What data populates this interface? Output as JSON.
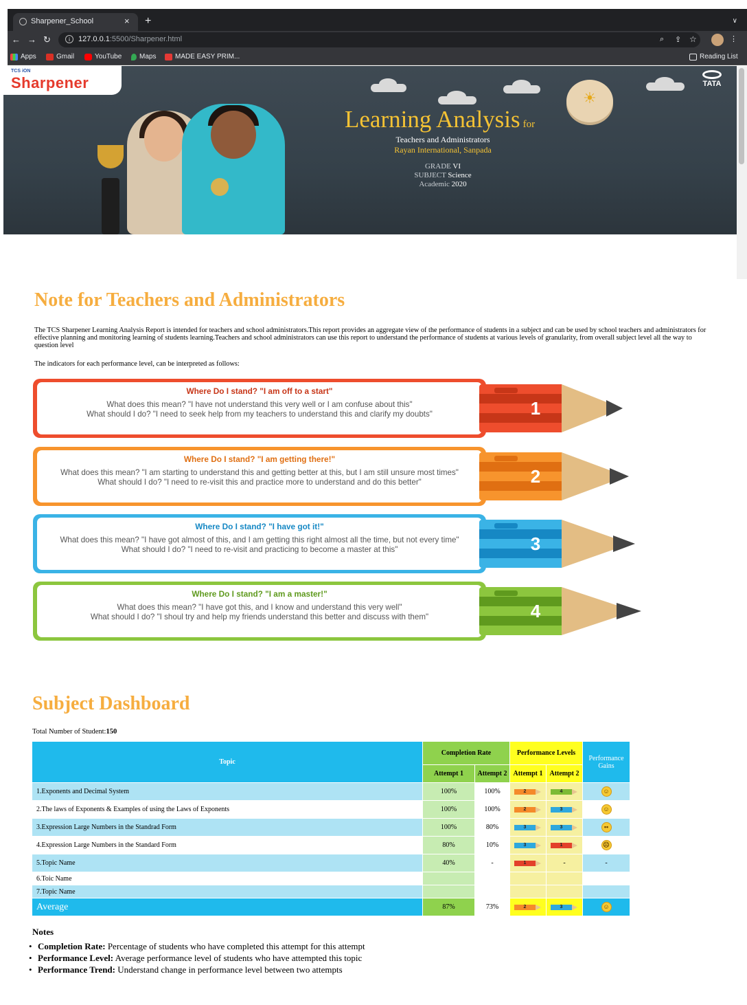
{
  "browser": {
    "tab_title": "Sharpener_School",
    "tab_close": "×",
    "new_tab": "+",
    "url_host": "127.0.0.1",
    "url_path": ":5500/Sharpener.html",
    "bookmarks": [
      "Apps",
      "Gmail",
      "YouTube",
      "Maps",
      "MADE EASY PRIM..."
    ],
    "reading_list": "Reading List"
  },
  "hero": {
    "brand_small": "TCS iON",
    "brand": "Sharpener",
    "tata": "TATA",
    "title": "Learning Analysis",
    "title_for": "for",
    "audience": "Teachers and Administrators",
    "school": "Rayan International, Sanpada",
    "grade_label": "GRADE",
    "grade": "VI",
    "subject_label": "SUBJECT",
    "subject": "Science",
    "academic_label": "Academic",
    "academic": "2020"
  },
  "note": {
    "heading": "Note for Teachers and Administrators",
    "intro": "The TCS Sharpener Learning Analysis Report is intended for teachers and school administrators.This report provides an aggregate view of the performance of students in a subject and can be used by school teachers and administrators for effective planning and monitoring learning of students learning.Teachers and school administrators can use this report to understand the performance of students at various levels of granularity, from overall subject level all the way to question level",
    "indicators": "The indicators for each performance level, can be interpreted as follows:",
    "levels": [
      {
        "num": "1",
        "question": "Where Do I stand? \"I am off to a start\"",
        "meaning": "What does this mean? \"I have not understand this very well or I am confuse about this\"",
        "action": "What should I do? \"I need to seek help from my teachers to understand this and clarify my doubts\"",
        "color": "#ee4d2d",
        "dark": "#c73618"
      },
      {
        "num": "2",
        "question": "Where Do I stand? \"I am getting there!\"",
        "meaning": "What does this mean? \"I am starting to understand this and getting better at this, but I am still unsure most times\"",
        "action": "What should I do? \"I need to re-visit this and practice more to understand and do this better\"",
        "color": "#f7942d",
        "dark": "#e06f12"
      },
      {
        "num": "3",
        "question": "Where Do I stand? \"I have got it!\"",
        "meaning": "What does this mean? \"I have got almost of this, and I am getting this right almost all the time, but not every time\"",
        "action": "What should I do? \"I need to re-visit and practicing to become a master at this\"",
        "color": "#3ab3e6",
        "dark": "#1688c4"
      },
      {
        "num": "4",
        "question": "Where Do I stand? \"I am a master!\"",
        "meaning": "What does this mean? \"I have got this, and I know and understand this very well\"",
        "action": "What should I do? \"I shoul try and help my friends understand this better and discuss with them\"",
        "color": "#8cc63e",
        "dark": "#5f9a1e"
      }
    ]
  },
  "dashboard": {
    "heading": "Subject Dashboard",
    "total_label": "Total Number of Student:",
    "total": "150",
    "headers": {
      "topic": "Topic",
      "completion": "Completion Rate",
      "performance": "Performance Levels",
      "gains": "Performance Gains",
      "attempt1": "Attempt 1",
      "attempt2": "Attempt 2"
    },
    "rows": [
      {
        "topic": "1.Exponents and Decimal System",
        "c1": "100%",
        "c2": "100%",
        "p1": "2",
        "p2": "4",
        "gain": "happy"
      },
      {
        "topic": "2.The laws of Exponents & Examples of using the Laws of Exponents",
        "c1": "100%",
        "c2": "100%",
        "p1": "2",
        "p2": "3",
        "gain": "happy"
      },
      {
        "topic": "3.Expression Large Numbers in the Standrad Form",
        "c1": "100%",
        "c2": "80%",
        "p1": "3",
        "p2": "3",
        "gain": "neutral"
      },
      {
        "topic": "4.Expression Large Numbers in the Standard Form",
        "c1": "80%",
        "c2": "10%",
        "p1": "3",
        "p2": "1",
        "gain": "sad"
      },
      {
        "topic": "5.Topic Name",
        "c1": "40%",
        "c2": "-",
        "p1": "1",
        "p2": "-",
        "gain": "-"
      },
      {
        "topic": "6.Toic Name",
        "c1": "",
        "c2": "",
        "p1": "",
        "p2": "",
        "gain": ""
      },
      {
        "topic": "7.Topic Name",
        "c1": "",
        "c2": "",
        "p1": "",
        "p2": "",
        "gain": ""
      }
    ],
    "average": {
      "label": "Average",
      "c1": "87%",
      "c2": "73%",
      "p1": "2",
      "p2": "3",
      "gain": "happy"
    },
    "notes_heading": "Notes",
    "notes": [
      {
        "term": "Completion Rate:",
        "text": "Percentage of students who have completed this attempt for this attempt"
      },
      {
        "term": "Performance Level:",
        "text": "Average performance level of students who have attempted this topic"
      },
      {
        "term": "Performance Trend:",
        "text": "Understand change in performance level between two attempts"
      }
    ]
  },
  "level_colors": {
    "1": "#e3412a",
    "2": "#f58a2a",
    "3": "#2fa8dd",
    "4": "#7dbb35"
  }
}
